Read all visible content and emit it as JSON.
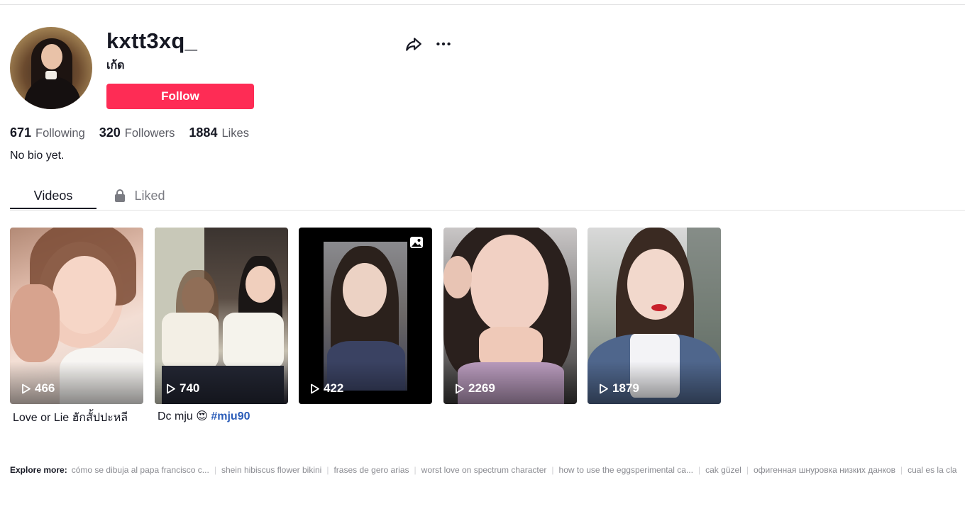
{
  "profile": {
    "username": "kxtt3xq_",
    "nickname": "เก้ด",
    "follow_label": "Follow",
    "bio": "No bio yet."
  },
  "stats": {
    "following": {
      "value": "671",
      "label": "Following"
    },
    "followers": {
      "value": "320",
      "label": "Followers"
    },
    "likes": {
      "value": "1884",
      "label": "Likes"
    }
  },
  "icons": {
    "share": "share-icon",
    "more": "more-options-icon",
    "lock": "lock-icon",
    "play": "play-icon",
    "photo": "photo-icon"
  },
  "tabs": {
    "videos": "Videos",
    "liked": "Liked"
  },
  "videos": [
    {
      "views": "466",
      "caption": "Love or Lie ฮักสั้ปปะหลี",
      "hashtag": ""
    },
    {
      "views": "740",
      "caption": "Dc mju 😍",
      "hashtag": "#mju90"
    },
    {
      "views": "422",
      "caption": "",
      "hashtag": "",
      "is_photo": true
    },
    {
      "views": "2269",
      "caption": "",
      "hashtag": ""
    },
    {
      "views": "1879",
      "caption": "",
      "hashtag": ""
    }
  ],
  "explore": {
    "heading": "Explore more:",
    "links": [
      "cómo se dibuja al papa francisco c...",
      "shein hibiscus flower bikini",
      "frases de gero arias",
      "worst love on spectrum character",
      "how to use the eggsperimental ca...",
      "cak güzel",
      "офигенная шнуровка низких данков",
      "cual es la cla"
    ]
  },
  "colors": {
    "accent": "#fe2c55",
    "text": "#161823",
    "hashtag": "#2b5db9"
  }
}
